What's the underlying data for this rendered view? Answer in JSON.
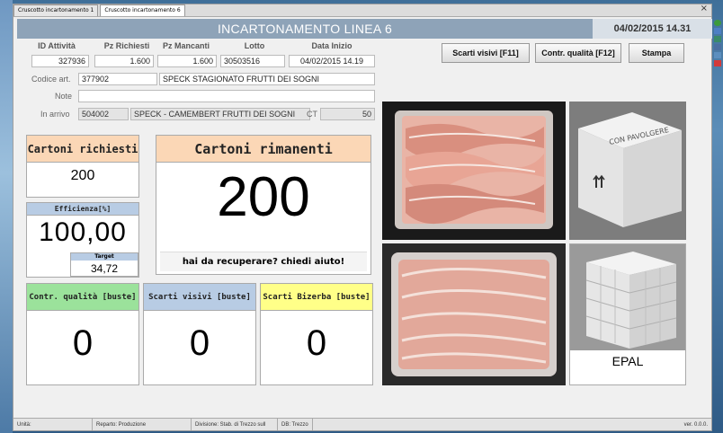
{
  "tabs": [
    "Cruscotto incartonamento 1",
    "Cruscotto incartonamento 6"
  ],
  "window_close": "×",
  "header": {
    "title": "INCARTONAMENTO LINEA 6",
    "datetime": "04/02/2015 14.31"
  },
  "columns": {
    "id_attivita": {
      "label": "ID Attività",
      "value": "327936"
    },
    "pz_richiesti": {
      "label": "Pz Richiesti",
      "value": "1.600"
    },
    "pz_mancanti": {
      "label": "Pz Mancanti",
      "value": "1.600"
    },
    "lotto": {
      "label": "Lotto",
      "value": "30503516"
    },
    "data_inizio": {
      "label": "Data Inizio",
      "value": "04/02/2015 14.19"
    }
  },
  "codice": {
    "label": "Codice art.",
    "code": "377902",
    "description": "SPECK STAGIONATO FRUTTI DEI SOGNI"
  },
  "note": {
    "label": "Note",
    "value": ""
  },
  "in_arrivo": {
    "label": "In arrivo",
    "code": "504002",
    "description": "SPECK - CAMEMBERT FRUTTI DEI SOGNI",
    "ct_label": "CT",
    "ct_value": "50"
  },
  "buttons": {
    "scarti_visivi": "Scarti visivi [F11]",
    "contr_qualita": "Contr. qualità [F12]",
    "stampa": "Stampa"
  },
  "cartoni_richiesti": {
    "label": "Cartoni richiesti",
    "value": "200"
  },
  "efficienza": {
    "label": "Efficienza[%]",
    "value": "100,00",
    "target_label": "Target",
    "target_value": "34,72"
  },
  "cartoni_rimanenti": {
    "label": "Cartoni rimanenti",
    "value": "200",
    "help": "hai da recuperare? chiedi aiuto!"
  },
  "counters": {
    "contr_qualita": {
      "label": "Contr. qualità [buste]",
      "value": "0"
    },
    "scarti_visivi": {
      "label": "Scarti visivi [buste]",
      "value": "0"
    },
    "scarti_bizerba": {
      "label": "Scarti Bizerba [buste]",
      "value": "0"
    }
  },
  "box_label": "CON PAVOLGERE",
  "pallet_label": "EPAL",
  "status": {
    "unita": "Unità:",
    "reparto": "Reparto: Produzione",
    "divisione": "Divisione: Stab. di Trezzo sull",
    "db": "DB: Trezzo",
    "version": "ver. 0.0.0."
  },
  "colors": {
    "header_orange": "#fbd7b6",
    "header_blue": "#b8cce4",
    "header_green": "#9be29b",
    "header_yellow": "#ffff88",
    "titlebar": "#8ea3b8"
  }
}
